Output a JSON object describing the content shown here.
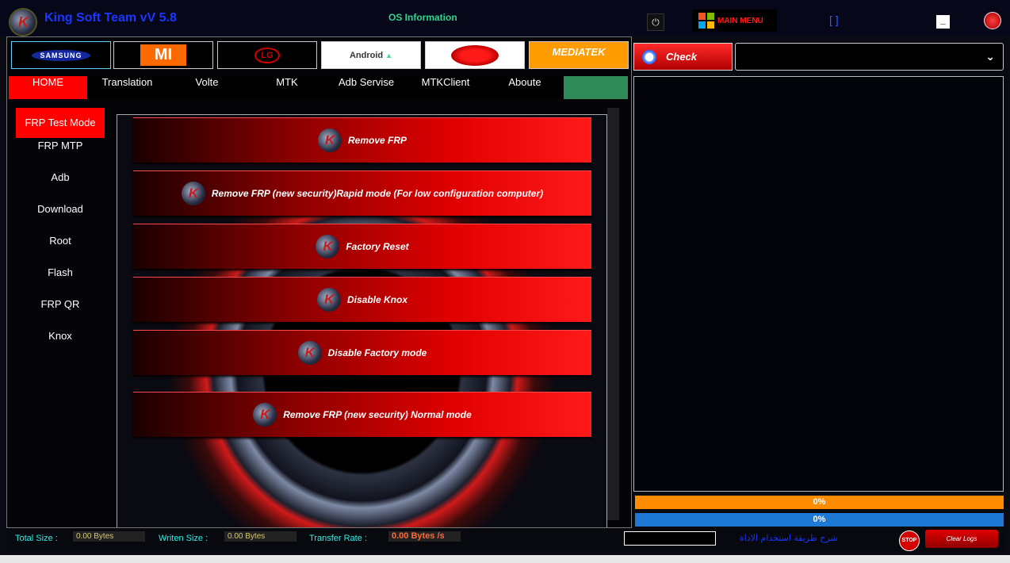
{
  "titlebar": {
    "logo_letter": "K",
    "app_title": "King Soft Team vV 5.8",
    "os_info": "OS Information",
    "power_glyph": "⏻",
    "main_menu_label": "MAIN MENU",
    "bracket_label": "[ ]",
    "minimize_glyph": "_"
  },
  "brands": [
    "SAMSUNG",
    "MI",
    "LG",
    "Android",
    "",
    "MEDIATEK"
  ],
  "tabs": {
    "home": "HOME",
    "translation": "Translation",
    "volte": "Volte",
    "mtk": "MTK",
    "adb": "Adb Servise",
    "mtkclient": "MTKClient",
    "aboute": "Aboute"
  },
  "side_menu": [
    "FRP Test Mode",
    "FRP MTP",
    "Adb",
    "Download",
    "Root",
    "Flash",
    "FRP QR",
    "Knox"
  ],
  "actions": [
    "Remove FRP",
    "Remove FRP (new security)Rapid mode (For low configuration computer)",
    "Factory Reset",
    "Disable Knox",
    "Disable Factory mode",
    "Remove FRP (new security) Normal mode"
  ],
  "right": {
    "check_label": "Check",
    "port_value": "",
    "progress_1": "0%",
    "progress_2": "0%"
  },
  "status": {
    "total_size_label": "Total Size :",
    "total_size_value": "0.00 Bytes",
    "written_size_label": "Writen Size :",
    "written_size_value": "0.00 Bytes",
    "transfer_rate_label": "Transfer Rate :",
    "transfer_rate_value": "0.00 Bytes /s",
    "arabic_link": "شرح طريقة استخدام الاداة",
    "stop_label": "STOP",
    "clear_logs_label": "Clear Logs"
  },
  "colors": {
    "accent_red": "#ff0000",
    "progress_orange": "#ff8c00",
    "progress_blue": "#1e78d6",
    "tab_green": "#2e8b57"
  }
}
